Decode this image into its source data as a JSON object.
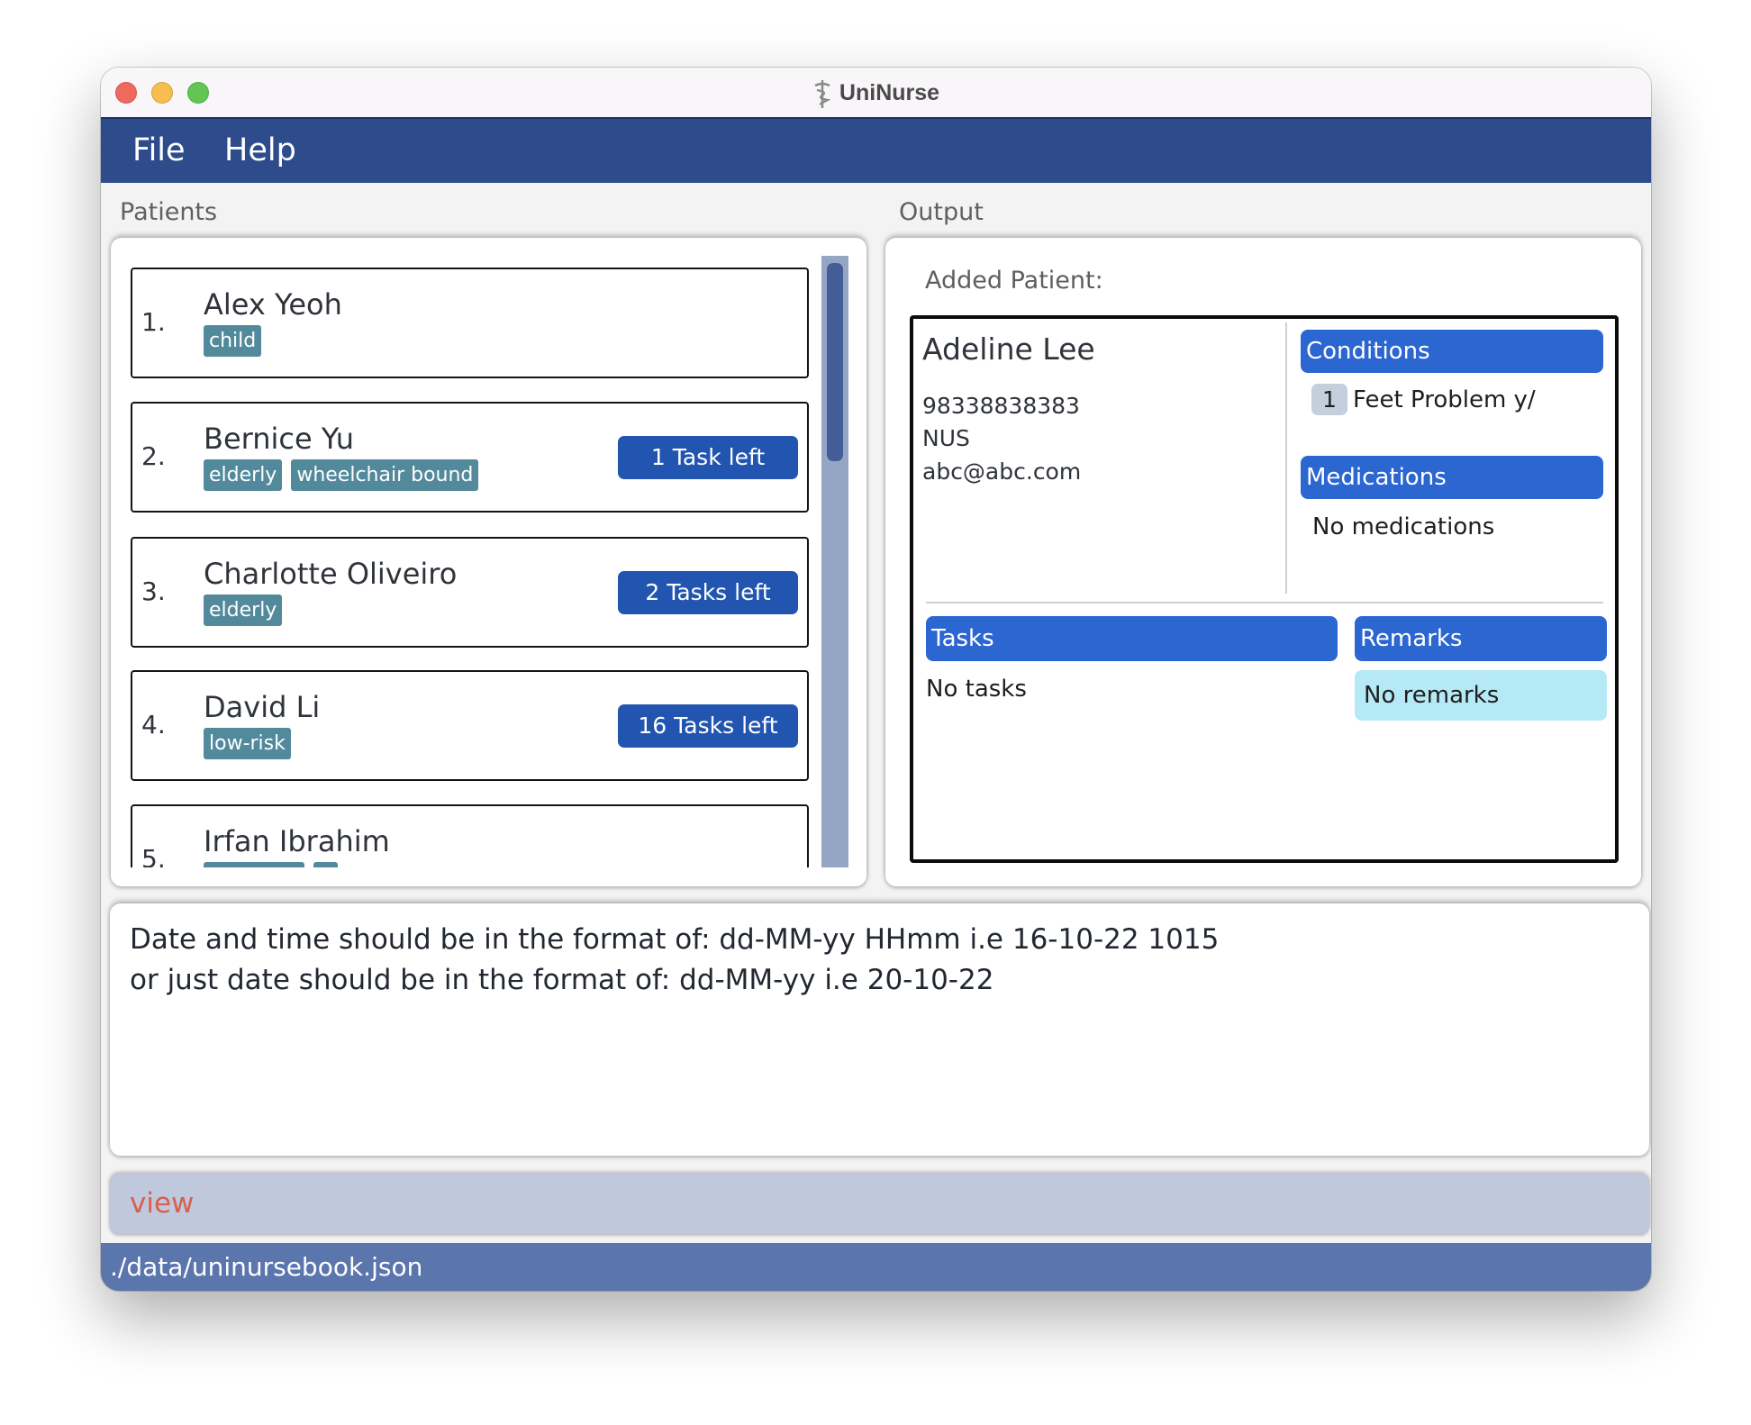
{
  "window": {
    "title": "UniNurse",
    "title_icon": "caduceus-icon"
  },
  "menu": {
    "items": [
      {
        "label": "File"
      },
      {
        "label": "Help"
      }
    ]
  },
  "patients_panel": {
    "label": "Patients",
    "patients": [
      {
        "index": "1.",
        "name": "Alex Yeoh",
        "tags": [
          "child"
        ],
        "tasks_left": null
      },
      {
        "index": "2.",
        "name": "Bernice Yu",
        "tags": [
          "elderly",
          "wheelchair bound"
        ],
        "tasks_left": "1 Task left"
      },
      {
        "index": "3.",
        "name": "Charlotte Oliveiro",
        "tags": [
          "elderly"
        ],
        "tasks_left": "2 Tasks left"
      },
      {
        "index": "4.",
        "name": "David Li",
        "tags": [
          "low-risk"
        ],
        "tasks_left": "16 Tasks left"
      },
      {
        "index": "5.",
        "name": "Irfan Ibrahim",
        "tags": [
          "",
          ""
        ],
        "tasks_left": null
      }
    ],
    "scroll_position": 0.0
  },
  "output_panel": {
    "label": "Output",
    "heading": "Added Patient:",
    "patient": {
      "name": "Adeline Lee",
      "phone": "98338838383",
      "address": "NUS",
      "email": "abc@abc.com",
      "conditions_header": "Conditions",
      "conditions": [
        {
          "index": "1",
          "text": "Feet Problem y/"
        }
      ],
      "medications_header": "Medications",
      "medications_empty": "No medications",
      "tasks_header": "Tasks",
      "tasks_empty": "No tasks",
      "remarks_header": "Remarks",
      "remarks_empty": "No remarks"
    }
  },
  "result_display": {
    "lines": [
      "Date and time should be in the format of: dd-MM-yy HHmm i.e 16-10-22 1015",
      "or just date should be in the format of: dd-MM-yy i.e 20-10-22"
    ]
  },
  "command_box": {
    "value": "view"
  },
  "status_bar": {
    "file_path": "./data/uninursebook.json"
  },
  "colors": {
    "menu_bar": "#2e4c8c",
    "status_bar": "#5b75ad",
    "command_box": "#bfc8dc",
    "command_text_error": "#d9604a",
    "tag": "#528a9b",
    "task_badge": "#2255b0",
    "section_header": "#2b66d1",
    "remarks_bg": "#b6e9f6"
  }
}
